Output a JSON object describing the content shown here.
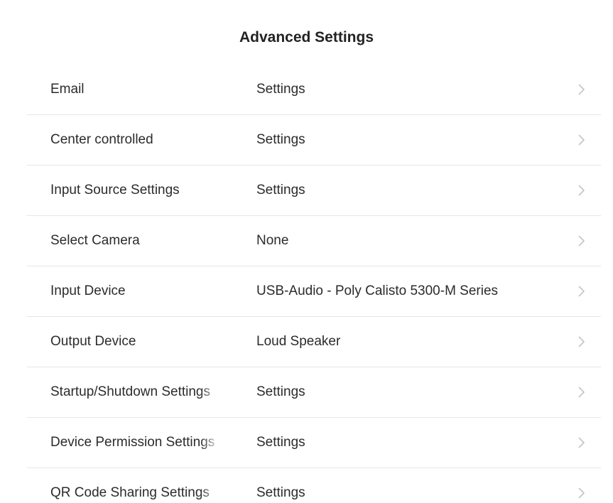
{
  "header": {
    "title": "Advanced Settings"
  },
  "settings": {
    "rows": [
      {
        "label": "Email",
        "value": "Settings"
      },
      {
        "label": "Center controlled",
        "value": "Settings"
      },
      {
        "label": "Input Source Settings",
        "value": "Settings"
      },
      {
        "label": "Select Camera",
        "value": "None"
      },
      {
        "label": "Input Device",
        "value": "USB-Audio - Poly Calisto 5300-M Series"
      },
      {
        "label": "Output Device",
        "value": "Loud Speaker"
      },
      {
        "label": "Startup/Shutdown Settings",
        "value": "Settings"
      },
      {
        "label": "Device Permission Settings",
        "value": "Settings"
      },
      {
        "label": "QR Code Sharing Settings",
        "value": "Settings"
      }
    ]
  },
  "icons": {
    "row_arrow": "chevron-right-icon"
  },
  "colors": {
    "text": "#2b2b2b",
    "divider": "#e6e6e6",
    "chevron": "#c4c4c4"
  }
}
